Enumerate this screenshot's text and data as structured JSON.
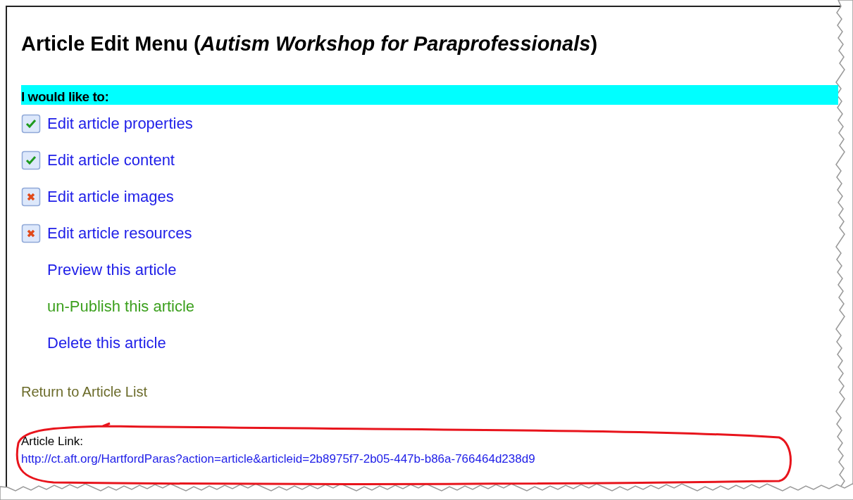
{
  "title": {
    "prefix": "Article Edit Menu (",
    "article": "Autism Workshop for Paraprofessionals",
    "suffix": ")"
  },
  "section_heading": "I would like to:",
  "actions": [
    {
      "kind": "task",
      "label": "Edit article properties",
      "checked": true
    },
    {
      "kind": "task",
      "label": "Edit article content",
      "checked": true
    },
    {
      "kind": "task",
      "label": "Edit article images",
      "checked": false
    },
    {
      "kind": "task",
      "label": "Edit article resources",
      "checked": false
    },
    {
      "kind": "link",
      "label": "Preview this article",
      "color": "#2020e8"
    },
    {
      "kind": "link",
      "label": "un-Publish this article",
      "color": "#3ca01e"
    },
    {
      "kind": "link",
      "label": "Delete this article",
      "color": "#2020e8"
    }
  ],
  "return_link": "Return to Article List",
  "article_link": {
    "label": "Article Link:",
    "url": "http://ct.aft.org/HartfordParas?action=article&articleid=2b8975f7-2b05-447b-b86a-766464d238d9"
  }
}
